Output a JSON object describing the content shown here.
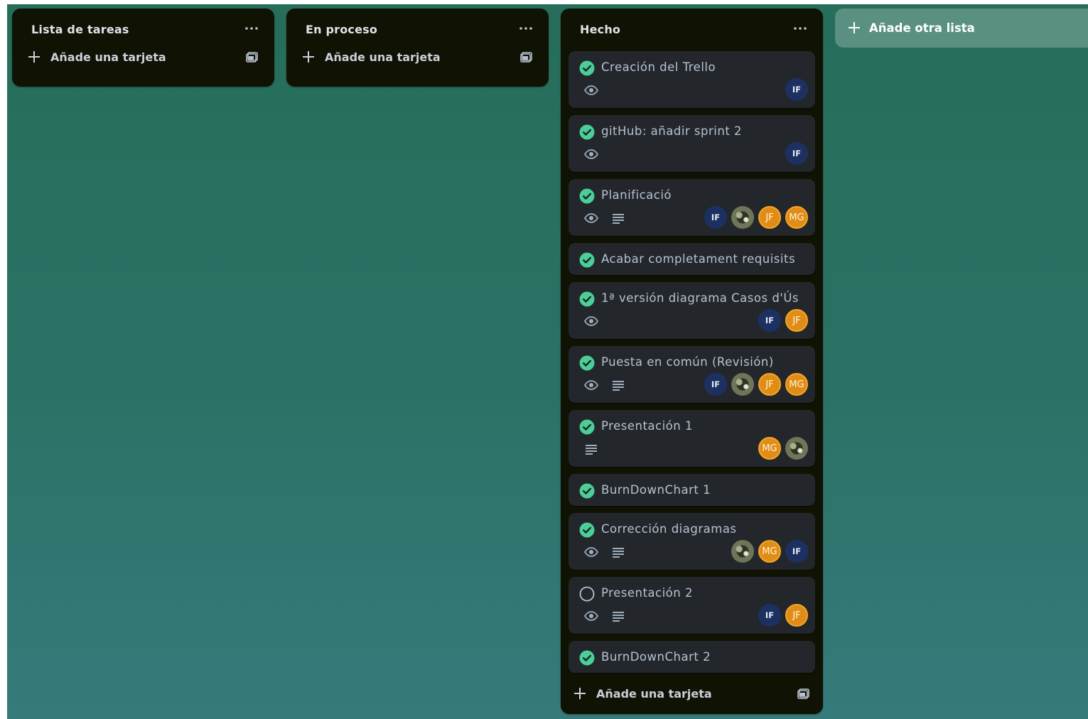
{
  "lists": [
    {
      "title": "Lista de tareas",
      "add_label": "Añade una tarjeta"
    },
    {
      "title": "En proceso",
      "add_label": "Añade una tarjeta"
    },
    {
      "title": "Hecho",
      "add_label": "Añade una tarjeta"
    }
  ],
  "add_list_label": "Añade otra lista",
  "cards": [
    {
      "title": "Creación del Trello",
      "done": true,
      "watching": true,
      "description": false,
      "members": [
        "IF"
      ]
    },
    {
      "title": "gitHub: añadir sprint 2",
      "done": true,
      "watching": true,
      "description": false,
      "members": [
        "IF"
      ]
    },
    {
      "title": "Planificació",
      "done": true,
      "watching": true,
      "description": true,
      "members": [
        "IF",
        "photo",
        "JF",
        "MG"
      ]
    },
    {
      "title": "Acabar completament requisits",
      "done": true,
      "watching": false,
      "description": false,
      "members": []
    },
    {
      "title": "1ª versión diagrama Casos d'Ús",
      "done": true,
      "watching": true,
      "description": false,
      "members": [
        "IF",
        "JF"
      ]
    },
    {
      "title": "Puesta en común (Revisión)",
      "done": true,
      "watching": true,
      "description": true,
      "members": [
        "IF",
        "photo",
        "JF",
        "MG"
      ]
    },
    {
      "title": "Presentación 1",
      "done": true,
      "watching": false,
      "description": true,
      "members": [
        "MG",
        "photo"
      ]
    },
    {
      "title": "BurnDownChart 1",
      "done": true,
      "watching": false,
      "description": false,
      "members": []
    },
    {
      "title": "Corrección diagramas",
      "done": true,
      "watching": true,
      "description": true,
      "members": [
        "photo",
        "MG",
        "IF"
      ]
    },
    {
      "title": "Presentación 2",
      "done": false,
      "watching": true,
      "description": true,
      "members": [
        "IF",
        "JF"
      ]
    },
    {
      "title": "BurnDownChart 2",
      "done": true,
      "watching": false,
      "description": false,
      "members": []
    }
  ],
  "colors": {
    "board_top": "#266e5a",
    "board_bottom": "#357b7b",
    "list_bg": "#101204",
    "card_bg": "#23272c",
    "complete_green": "#4bce97",
    "avatar_navy": "#1c3161",
    "avatar_orange": "#e08d18"
  },
  "icons": {
    "list_menu": "ellipsis-icon",
    "add": "plus-icon",
    "template": "card-template-icon",
    "complete": "check-circle-icon",
    "incomplete": "empty-circle-icon",
    "watch": "eye-icon",
    "description": "description-lines-icon"
  }
}
